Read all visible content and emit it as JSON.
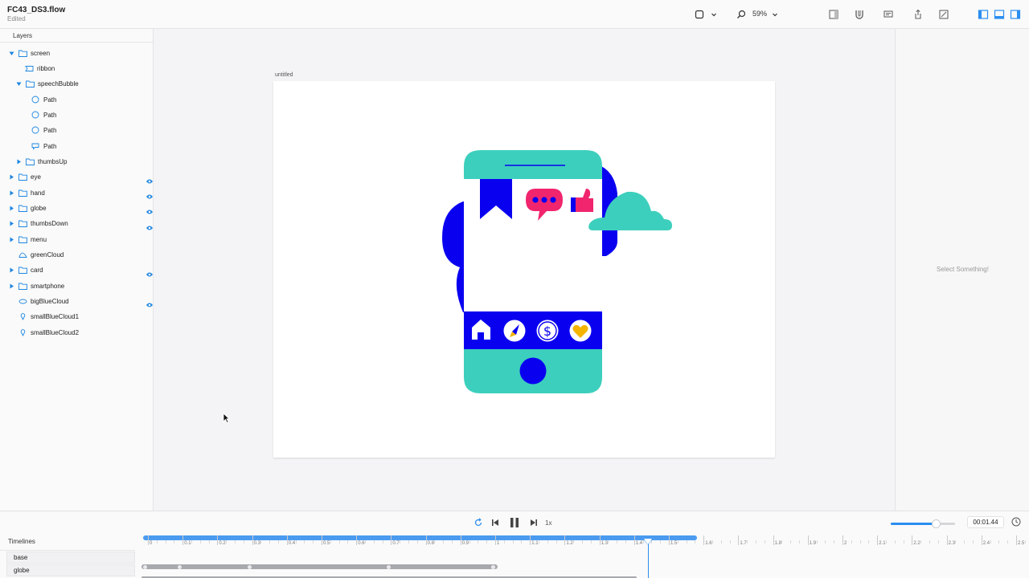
{
  "document": {
    "title": "FC43_DS3.flow",
    "status": "Edited"
  },
  "toolbar": {
    "zoom": "59%"
  },
  "layers_panel": {
    "title": "Layers",
    "items": [
      {
        "label": "screen",
        "expanded": true,
        "icon": "folder-icon",
        "visible_toggle": false
      },
      {
        "label": "ribbon",
        "icon": "rectangle-icon",
        "visible_toggle": false
      },
      {
        "label": "speechBubble",
        "expanded": true,
        "icon": "folder-icon",
        "visible_toggle": false
      },
      {
        "label": "Path",
        "icon": "circle-path-icon",
        "visible_toggle": false
      },
      {
        "label": "Path",
        "icon": "circle-path-icon",
        "visible_toggle": false
      },
      {
        "label": "Path",
        "icon": "circle-path-icon",
        "visible_toggle": false
      },
      {
        "label": "Path",
        "icon": "speech-path-icon",
        "visible_toggle": false
      },
      {
        "label": "thumbsUp",
        "expanded": false,
        "icon": "folder-icon",
        "visible_toggle": false
      },
      {
        "label": "eye",
        "expanded": false,
        "icon": "folder-icon",
        "visible_toggle": true
      },
      {
        "label": "hand",
        "expanded": false,
        "icon": "folder-icon",
        "visible_toggle": true
      },
      {
        "label": "globe",
        "expanded": false,
        "icon": "folder-icon",
        "visible_toggle": true
      },
      {
        "label": "thumbsDown",
        "expanded": false,
        "icon": "folder-icon",
        "visible_toggle": true
      },
      {
        "label": "menu",
        "expanded": false,
        "icon": "folder-icon",
        "visible_toggle": false
      },
      {
        "label": "greenCloud",
        "icon": "cloud-path-icon",
        "visible_toggle": false
      },
      {
        "label": "card",
        "expanded": false,
        "icon": "folder-icon",
        "visible_toggle": true
      },
      {
        "label": "smartphone",
        "expanded": false,
        "icon": "folder-icon",
        "visible_toggle": false
      },
      {
        "label": "bigBlueCloud",
        "icon": "oval-path-icon",
        "visible_toggle": true
      },
      {
        "label": "smallBlueCloud1",
        "icon": "pin-path-icon",
        "visible_toggle": false
      },
      {
        "label": "smallBlueCloud2",
        "icon": "pin-path-icon",
        "visible_toggle": false
      }
    ]
  },
  "canvas": {
    "artboard_name": "untitled"
  },
  "inspector": {
    "empty_message": "Select Something!"
  },
  "playback": {
    "speed": "1x",
    "time": "00:01.44",
    "state": "playing",
    "volume_level": 0.7
  },
  "timelines": {
    "title": "Timelines",
    "rows": [
      {
        "label": "base"
      },
      {
        "label": "globe"
      }
    ],
    "ticks": [
      "0",
      "0.1",
      "0.2",
      "0.3",
      "0.4",
      "0.5",
      "0.6",
      "0.7",
      "0.8",
      "0.9",
      "1",
      "1.1",
      "1.2",
      "1.3",
      "1.4",
      "1.5",
      "1.6",
      "1.7",
      "1.8",
      "1.9",
      "2",
      "2.1",
      "2.2",
      "2.3",
      "2.4",
      "2.5"
    ],
    "playhead_time": 1.44,
    "range_end": 1.58
  },
  "colors": {
    "accent": "#2b8ef0",
    "teal": "#3dcfbd",
    "blue": "#0a00f0",
    "pink": "#f0256e",
    "yellow": "#f5b400"
  }
}
